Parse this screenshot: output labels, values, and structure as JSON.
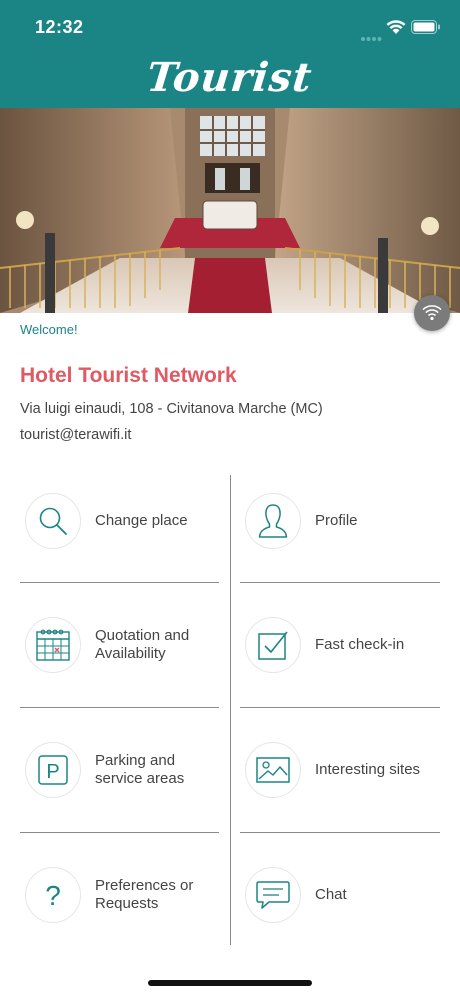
{
  "status_bar": {
    "time": "12:32"
  },
  "header": {
    "title": "Tourist"
  },
  "welcome": "Welcome!",
  "hotel": {
    "name": "Hotel Tourist Network",
    "address": "Via luigi einaudi, 108 - Civitanova Marche (MC)",
    "email": "tourist@terawifi.it"
  },
  "menu": [
    {
      "label": "Change place",
      "icon": "search-icon"
    },
    {
      "label": "Profile",
      "icon": "user-icon"
    },
    {
      "label": "Quotation and Availability",
      "icon": "calendar-icon"
    },
    {
      "label": "Fast check-in",
      "icon": "checkbox-icon"
    },
    {
      "label": "Parking and service areas",
      "icon": "parking-icon"
    },
    {
      "label": "Interesting sites",
      "icon": "image-icon"
    },
    {
      "label": "Preferences or Requests",
      "icon": "question-icon"
    },
    {
      "label": "Chat",
      "icon": "chat-icon"
    }
  ],
  "colors": {
    "primary": "#1b8586",
    "accent": "#e05a63"
  }
}
